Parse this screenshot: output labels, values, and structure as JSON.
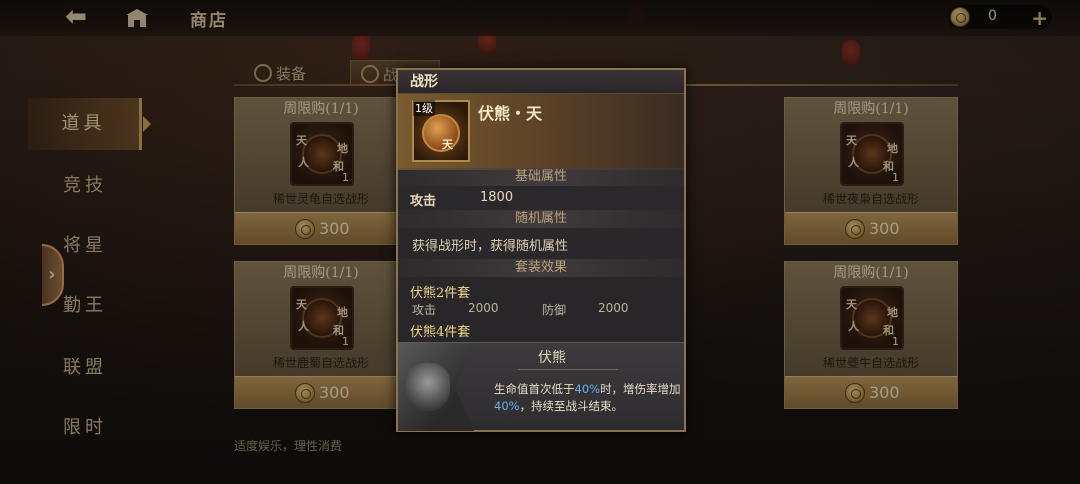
{
  "topbar": {
    "back_icon": "back-arrow-icon",
    "home_icon": "home-icon",
    "title": "商店",
    "currency_value": "0",
    "plus_label": "+"
  },
  "tabs": [
    {
      "label": "装备",
      "icon": "equipment-icon",
      "active": false
    },
    {
      "label": "战形",
      "icon": "formation-icon",
      "active": true
    }
  ],
  "sidebar": {
    "expand_label": "›",
    "items": [
      {
        "label": "道具",
        "active": true
      },
      {
        "label": "竞技",
        "active": false
      },
      {
        "label": "将星",
        "active": false
      },
      {
        "label": "勤王",
        "active": false
      },
      {
        "label": "联盟",
        "active": false
      },
      {
        "label": "限时",
        "active": false
      }
    ]
  },
  "cards": [
    {
      "header": "周限购(1/1)",
      "name": "稀世灵龟自选战形",
      "qty": "1",
      "price": "300",
      "glyphs": [
        "天",
        "地",
        "人",
        "和"
      ]
    },
    {
      "header": "购(1/1)",
      "name": "自选战形",
      "qty": "1",
      "price": "300",
      "glyphs": [
        "天",
        "地",
        "人",
        "和"
      ]
    },
    {
      "header": "周限购(1/1)",
      "name": "稀世夜枭自选战形",
      "qty": "1",
      "price": "300",
      "glyphs": [
        "天",
        "地",
        "人",
        "和"
      ]
    },
    {
      "header": "周限购(1/1)",
      "name": "稀世鹿蜀自选战形",
      "qty": "1",
      "price": "300",
      "glyphs": [
        "天",
        "地",
        "人",
        "和"
      ]
    },
    {
      "header": "购(1/1)",
      "name": "自选战形",
      "qty": "1",
      "price": "300",
      "glyphs": [
        "天",
        "地",
        "人",
        "和"
      ]
    },
    {
      "header": "周限购(1/1)",
      "name": "稀世夔牛自选战形",
      "qty": "1",
      "price": "300",
      "glyphs": [
        "天",
        "地",
        "人",
        "和"
      ]
    }
  ],
  "footer_note": "适度娱乐，理性消费",
  "popup": {
    "title": "战形",
    "level": "1级",
    "icon_char": "天",
    "name": "伏熊・天",
    "base_header": "基础属性",
    "base_stat_label": "攻击",
    "base_stat_value": "1800",
    "random_header": "随机属性",
    "random_text": "获得战形时，获得随机属性",
    "set_header": "套装效果",
    "set2_title": "伏熊2件套",
    "set2_stat1_label": "攻击",
    "set2_stat1_value": "2000",
    "set2_stat2_label": "防御",
    "set2_stat2_value": "2000",
    "set4_title": "伏熊4件套",
    "skill_name": "伏熊",
    "skill_desc_1": "生命值首次低于",
    "skill_hl_1": "40%",
    "skill_desc_2": "时，增伤率增加",
    "skill_hl_2": "40%",
    "skill_desc_3": "，持续至战斗结束。"
  },
  "colors": {
    "accent_gold": "#c9a45a",
    "highlight_blue": "#6ab0f0",
    "expand_button": "#a07248"
  }
}
